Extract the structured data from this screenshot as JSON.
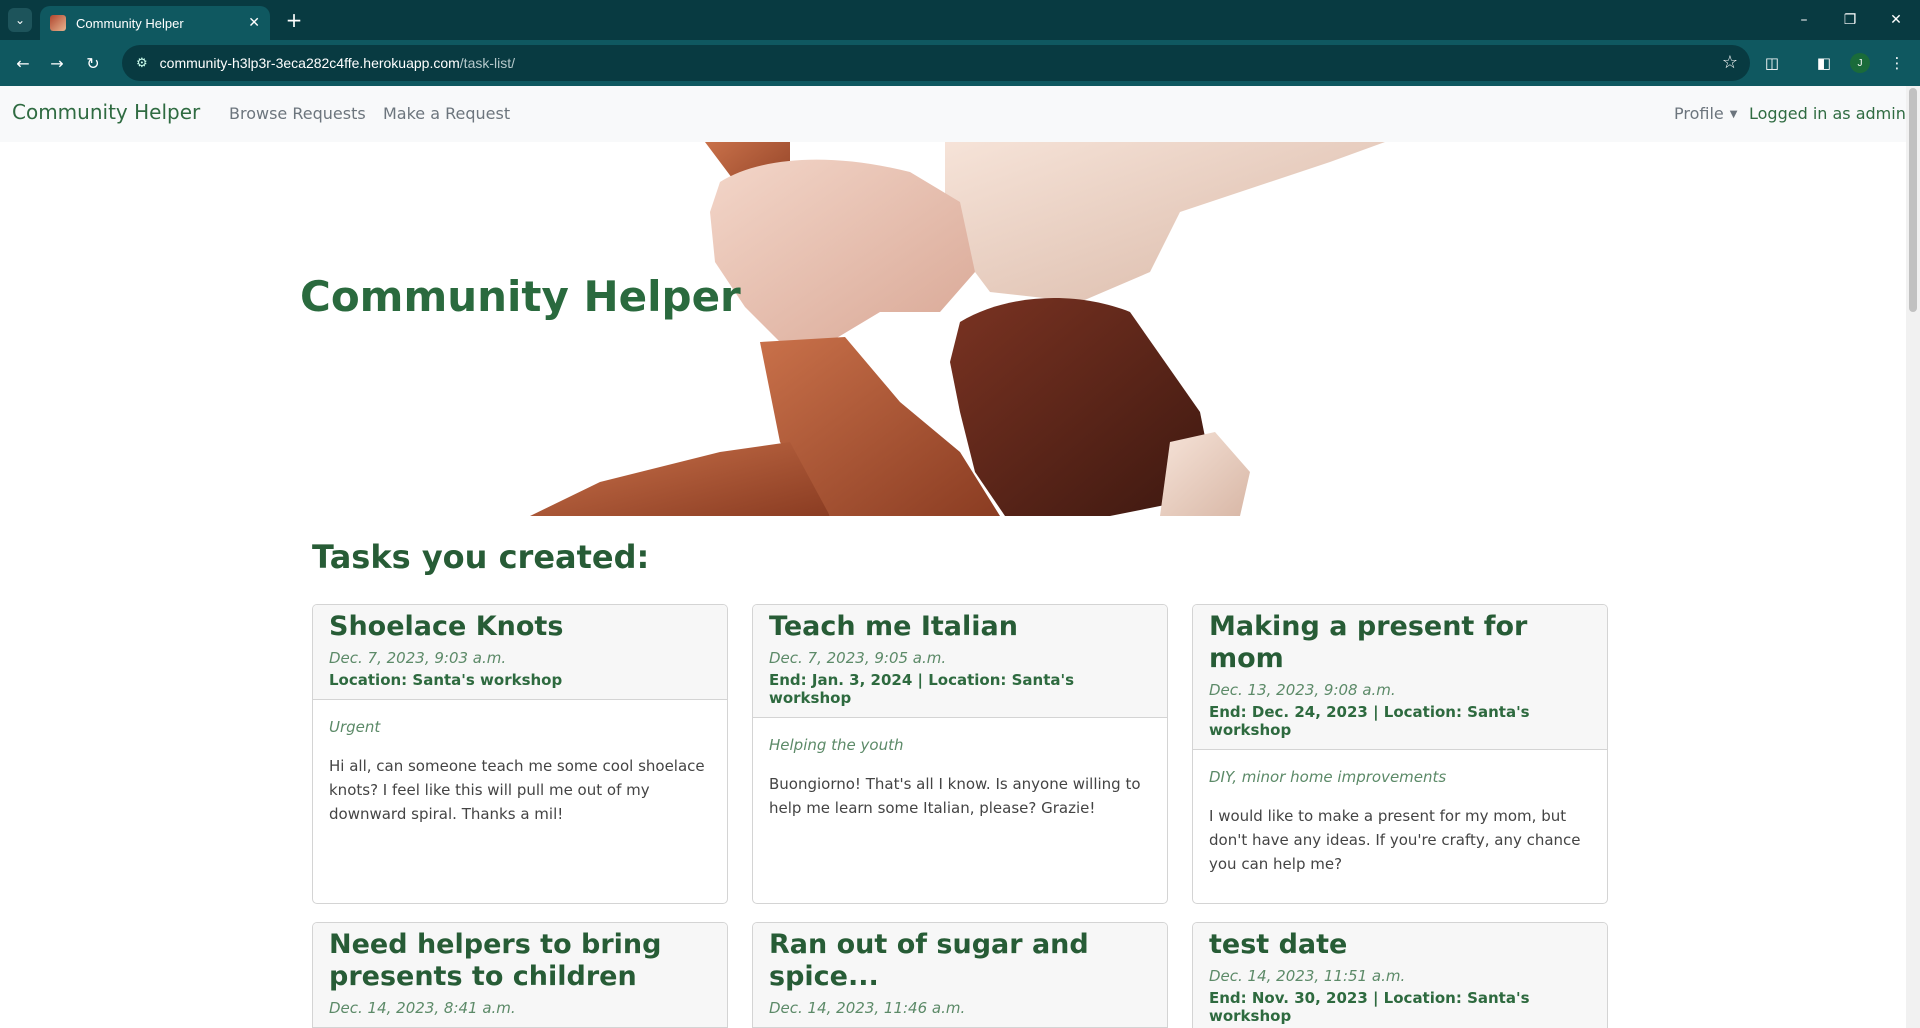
{
  "browser": {
    "tab_title": "Community Helper",
    "url_host": "community-h3lp3r-3eca282c4ffe.herokuapp.com",
    "url_path": "/task-list/",
    "profile_initial": "J"
  },
  "navbar": {
    "brand": "Community Helper",
    "links": [
      "Browse Requests",
      "Make a Request"
    ],
    "profile": "Profile",
    "logged_in": "Logged in as admin"
  },
  "hero": {
    "title": "Community Helper"
  },
  "section_title": "Tasks you created:",
  "tasks": [
    {
      "title": "Shoelace Knots",
      "date": "Dec. 7, 2023, 9:03 a.m.",
      "meta": "Location: Santa's workshop",
      "category": "Urgent",
      "description": "Hi all, can someone teach me some cool shoelace knots? I feel like this will pull me out of my downward spiral. Thanks a mil!"
    },
    {
      "title": "Teach me Italian",
      "date": "Dec. 7, 2023, 9:05 a.m.",
      "meta": "End: Jan. 3, 2024 | Location: Santa's workshop",
      "category": "Helping the youth",
      "description": "Buongiorno! That's all I know. Is anyone willing to help me learn some Italian, please? Grazie!"
    },
    {
      "title": "Making a present for mom",
      "date": "Dec. 13, 2023, 9:08 a.m.",
      "meta": "End: Dec. 24, 2023 | Location: Santa's workshop",
      "category": "DIY, minor home improvements",
      "description": "I would like to make a present for my mom, but don't have any ideas. If you're crafty, any chance you can help me?"
    },
    {
      "title": "Need helpers to bring presents to children",
      "date": "Dec. 14, 2023, 8:41 a.m.",
      "meta": "",
      "category": "",
      "description": ""
    },
    {
      "title": "Ran out of sugar and spice...",
      "date": "Dec. 14, 2023, 11:46 a.m.",
      "meta": "",
      "category": "",
      "description": ""
    },
    {
      "title": "test date",
      "date": "Dec. 14, 2023, 11:51 a.m.",
      "meta": "End: Nov. 30, 2023 | Location: Santa's workshop",
      "category": "",
      "description": ""
    }
  ]
}
